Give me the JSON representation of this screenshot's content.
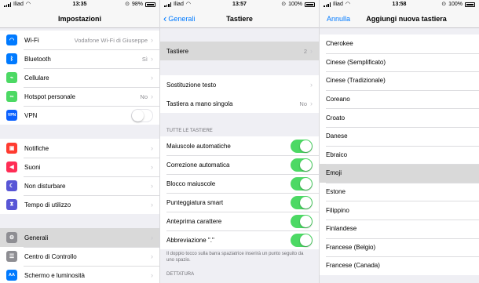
{
  "panel1": {
    "status": {
      "carrier": "Iliad",
      "time": "13:35",
      "battery": "98%"
    },
    "title": "Impostazioni",
    "rows": [
      {
        "label": "Wi-Fi",
        "value": "Vodafone Wi-Fi di Giuseppe",
        "icon": "wifi-icon",
        "color": "#007aff"
      },
      {
        "label": "Bluetooth",
        "value": "Sì",
        "icon": "bluetooth-icon",
        "color": "#007aff"
      },
      {
        "label": "Cellulare",
        "value": "",
        "icon": "antenna-icon",
        "color": "#4cd964"
      },
      {
        "label": "Hotspot personale",
        "value": "No",
        "icon": "hotspot-icon",
        "color": "#4cd964"
      },
      {
        "label": "VPN",
        "value": "",
        "icon": "vpn-icon",
        "color": "#0a60ff",
        "badge": "VPN"
      },
      {
        "label": "Notifiche",
        "value": "",
        "icon": "notification-icon",
        "color": "#ff3b30"
      },
      {
        "label": "Suoni",
        "value": "",
        "icon": "speaker-icon",
        "color": "#ff2d55"
      },
      {
        "label": "Non disturbare",
        "value": "",
        "icon": "moon-icon",
        "color": "#5856d6"
      },
      {
        "label": "Tempo di utilizzo",
        "value": "",
        "icon": "hourglass-icon",
        "color": "#5856d6"
      },
      {
        "label": "Generali",
        "value": "",
        "icon": "gear-icon",
        "color": "#8e8e93"
      },
      {
        "label": "Centro di Controllo",
        "value": "",
        "icon": "control-center-icon",
        "color": "#8e8e93"
      },
      {
        "label": "Schermo e luminosità",
        "value": "",
        "icon": "brightness-icon",
        "color": "#007aff",
        "badge": "AA"
      }
    ]
  },
  "panel2": {
    "status": {
      "carrier": "Iliad",
      "time": "13:57",
      "battery": "100%"
    },
    "back": "Generali",
    "title": "Tastiere",
    "keyboards_label": "Tastiere",
    "keyboards_count": "2",
    "rows_a": [
      {
        "label": "Sostituzione testo",
        "value": ""
      },
      {
        "label": "Tastiera a mano singola",
        "value": "No"
      }
    ],
    "section_all": "TUTTE LE TASTIERE",
    "toggles": [
      {
        "label": "Maiuscole automatiche",
        "on": true
      },
      {
        "label": "Correzione automatica",
        "on": true
      },
      {
        "label": "Blocco maiuscole",
        "on": true
      },
      {
        "label": "Punteggiatura smart",
        "on": true
      },
      {
        "label": "Anteprima carattere",
        "on": true
      },
      {
        "label": "Abbreviazione \".\"",
        "on": true
      }
    ],
    "footer": "Il doppio tocco sulla barra spaziatrice inserirà un punto seguito da uno spazio.",
    "section_dictation": "DETTATURA"
  },
  "panel3": {
    "status": {
      "carrier": "Iliad",
      "time": "13:58",
      "battery": "100%"
    },
    "cancel": "Annulla",
    "title": "Aggiungi nuova tastiera",
    "languages": [
      "Cherokee",
      "Cinese (Semplificato)",
      "Cinese (Tradizionale)",
      "Coreano",
      "Croato",
      "Danese",
      "Ebraico",
      "Emoji",
      "Estone",
      "Filippino",
      "Finlandese",
      "Francese (Belgio)",
      "Francese (Canada)"
    ],
    "selected": "Emoji"
  }
}
